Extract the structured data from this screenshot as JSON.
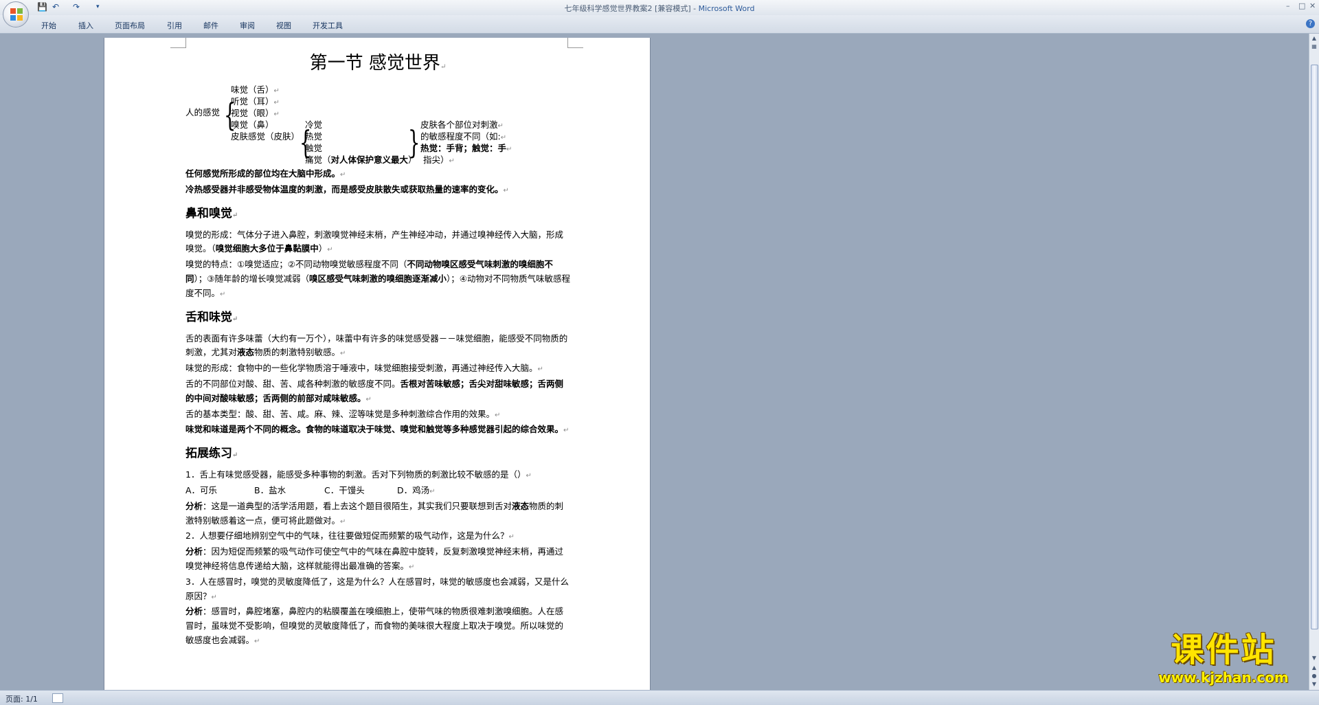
{
  "window": {
    "title_doc": "七年级科学感觉世界教案2 [兼容模式] - ",
    "title_app": "Microsoft Word"
  },
  "ribbon": {
    "tabs": [
      "开始",
      "插入",
      "页面布局",
      "引用",
      "邮件",
      "审阅",
      "视图",
      "开发工具"
    ]
  },
  "doc": {
    "heading": "第一节 感觉世界",
    "tree": {
      "root": "人的感觉",
      "senses": [
        "味觉（舌）",
        "听觉（耳）",
        "视觉（眼）",
        "嗅觉（鼻）",
        "皮肤感觉（皮肤）"
      ],
      "skin": [
        "冷觉",
        "热觉",
        "触觉",
        "痛觉（"
      ],
      "pain_bold": "对人体保护意义最大",
      "pain_close": "）",
      "note": [
        "皮肤各个部位对刺激",
        "的敏感程度不同（如:"
      ],
      "note_bold": "热觉：手背；触觉：手",
      "note_end": "指尖）"
    },
    "summary": [
      "任何感觉所形成的部位均在大脑中形成。",
      "冷热感受器并非感受物体温度的刺激，而是感受皮肤散失或获取热量的速率的变化。"
    ],
    "nose": {
      "heading": "鼻和嗅觉",
      "p1_pre": "嗅觉的形成：气体分子进入鼻腔，刺激嗅觉神经末梢，产生神经冲动，并通过嗅神经传入大脑，形成嗅觉。（",
      "p1_bold": "嗅觉细胞大多位于鼻黏膜中",
      "p1_post": "）",
      "p2_a": "嗅觉的特点：①嗅觉适应；②不同动物嗅觉敏感程度不同（",
      "p2_b": "不同动物嗅区感受气味刺激的嗅细胞不同",
      "p2_c": "）；③随年龄的增长嗅觉减弱（",
      "p2_d": "嗅区感受气味刺激的嗅细胞逐渐减小",
      "p2_e": "）；④动物对不同物质气味敏感程度不同。"
    },
    "tongue": {
      "heading": "舌和味觉",
      "p1_pre": "舌的表面有许多味蕾（大约有一万个），味蕾中有许多的味觉感受器－－味觉细胞，能感受不同物质的刺激，尤其对",
      "p1_bold": "液态",
      "p1_post": "物质的刺激特别敏感。",
      "p2": "味觉的形成：食物中的一些化学物质溶于唾液中，味觉细胞接受刺激，再通过神经传入大脑。",
      "p3_pre": "舌的不同部位对酸、甜、苦、咸各种刺激的敏感度不同。",
      "p3_bold": "舌根对苦味敏感；舌尖对甜味敏感；舌两侧的中间对酸味敏感；舌两侧的前部对咸味敏感。",
      "p4": "舌的基本类型：酸、甜、苦、咸。麻、辣、涩等味觉是多种刺激综合作用的效果。",
      "p5_bold": "味觉和味道是两个不同的概念。食物的味道取决于味觉、嗅觉和触觉等多种感觉器引起的综合效果。"
    },
    "exercise": {
      "heading": "拓展练习",
      "q1": "1．舌上有味觉感受器，能感受多种事物的刺激。舌对下列物质的刺激比较不敏感的是（）",
      "options": [
        "A．可乐",
        "B．盐水",
        "C．干馒头",
        "D．鸡汤"
      ],
      "label": "分析",
      "a1_pre": "：这是一道典型的活学活用题，看上去这个题目很陌生，其实我们只要联想到舌对",
      "a1_bold": "液态",
      "a1_post": "物质的刺激特别敏感着这一点，便可将此题做对。",
      "q2": "2．人想要仔细地辨别空气中的气味，往往要做短促而频繁的吸气动作，这是为什么？",
      "a2": "：因为短促而频繁的吸气动作可使空气中的气味在鼻腔中旋转，反复刺激嗅觉神经末梢，再通过嗅觉神经将信息传递给大脑，这样就能得出最准确的答案。",
      "q3": "3．人在感冒时，嗅觉的灵敏度降低了，这是为什么？人在感冒时，味觉的敏感度也会减弱，又是什么原因？",
      "a3": "：感冒时，鼻腔堵塞，鼻腔内的粘膜覆盖在嗅细胞上，使带气味的物质很难刺激嗅细胞。人在感冒时，虽味觉不受影响，但嗅觉的灵敏度降低了，而食物的美味很大程度上取决于嗅觉。所以味觉的敏感度也会减弱。"
    }
  },
  "status": {
    "page": "页面: 1/1"
  },
  "watermark": {
    "name": "课件站",
    "url": "www.kjzhan.com"
  }
}
